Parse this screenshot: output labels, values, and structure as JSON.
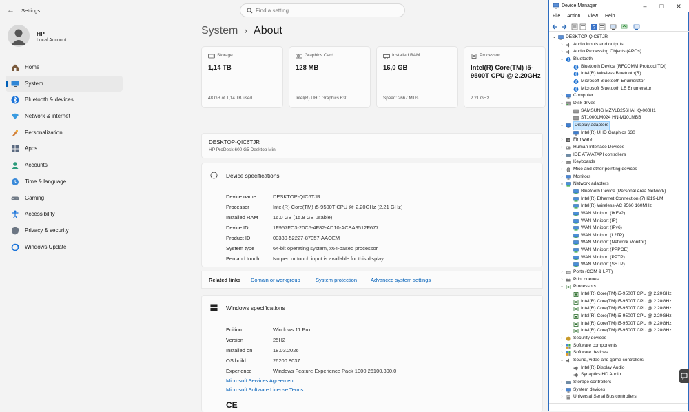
{
  "settings": {
    "title": "Settings",
    "search_placeholder": "Find a setting",
    "user": {
      "name": "HP",
      "account": "Local Account"
    },
    "nav": [
      {
        "label": "Home",
        "icon": "home-icon"
      },
      {
        "label": "System",
        "icon": "monitor-icon",
        "active": true
      },
      {
        "label": "Bluetooth & devices",
        "icon": "bluetooth-icon"
      },
      {
        "label": "Network & internet",
        "icon": "wifi-icon"
      },
      {
        "label": "Personalization",
        "icon": "brush-icon"
      },
      {
        "label": "Apps",
        "icon": "apps-icon"
      },
      {
        "label": "Accounts",
        "icon": "person-icon"
      },
      {
        "label": "Time & language",
        "icon": "globe-clock-icon"
      },
      {
        "label": "Gaming",
        "icon": "gamepad-icon"
      },
      {
        "label": "Accessibility",
        "icon": "accessibility-icon"
      },
      {
        "label": "Privacy & security",
        "icon": "shield-icon"
      },
      {
        "label": "Windows Update",
        "icon": "update-icon"
      }
    ],
    "breadcrumb": {
      "parent": "System",
      "sep": "›",
      "current": "About"
    },
    "cards": [
      {
        "label": "Storage",
        "value": "1,14 TB",
        "sub": "48 GB of 1,14 TB used",
        "icon": "storage-icon"
      },
      {
        "label": "Graphics Card",
        "value": "128 MB",
        "sub": "Intel(R) UHD Graphics 630",
        "icon": "graphics-card-icon"
      },
      {
        "label": "Installed RAM",
        "value": "16,0 GB",
        "sub": "Speed: 2667 MT/s",
        "icon": "ram-icon"
      },
      {
        "label": "Processor",
        "value": "Intel(R) Core(TM) i5-9500T CPU @ 2.20GHz",
        "sub": "2.21 GHz",
        "icon": "cpu-icon"
      }
    ],
    "device": {
      "name": "DESKTOP-QIC6TJR",
      "model": "HP ProDesk 600 G5 Desktop Mini"
    },
    "device_specs": {
      "title": "Device specifications",
      "rows": [
        {
          "k": "Device name",
          "v": "DESKTOP-QIC6TJR"
        },
        {
          "k": "Processor",
          "v": "Intel(R) Core(TM) i5-9500T CPU @ 2.20GHz (2.21 GHz)"
        },
        {
          "k": "Installed RAM",
          "v": "16.0 GB (15.8 GB usable)"
        },
        {
          "k": "Device ID",
          "v": "1F957FC3-20C5-4F82-AD10-ACBA9512F677"
        },
        {
          "k": "Product ID",
          "v": "00330-52227-87057-AAOEM"
        },
        {
          "k": "System type",
          "v": "64-bit operating system, x64-based processor"
        },
        {
          "k": "Pen and touch",
          "v": "No pen or touch input is available for this display"
        }
      ]
    },
    "related": {
      "label": "Related links",
      "links": [
        "Domain or workgroup",
        "System protection",
        "Advanced system settings"
      ]
    },
    "windows_specs": {
      "title": "Windows specifications",
      "rows": [
        {
          "k": "Edition",
          "v": "Windows 11 Pro"
        },
        {
          "k": "Version",
          "v": "25H2"
        },
        {
          "k": "Installed on",
          "v": "18.03.2026"
        },
        {
          "k": "OS build",
          "v": "26200.8037"
        },
        {
          "k": "Experience",
          "v": "Windows Feature Experience Pack 1000.26100.300.0"
        }
      ],
      "links": [
        "Microsoft Services Agreement",
        "Microsoft Software License Terms"
      ],
      "ce": "CE"
    }
  },
  "device_manager": {
    "title": "Device Manager",
    "menu": [
      "File",
      "Action",
      "View",
      "Help"
    ],
    "tree": [
      {
        "d": 0,
        "e": "v",
        "label": "DESKTOP-QIC6TJR",
        "icon": "computer-icon"
      },
      {
        "d": 1,
        "e": ">",
        "label": "Audio inputs and outputs",
        "icon": "speaker-icon"
      },
      {
        "d": 1,
        "e": ">",
        "label": "Audio Processing Objects (APOs)",
        "icon": "speaker-icon"
      },
      {
        "d": 1,
        "e": "v",
        "label": "Bluetooth",
        "icon": "bluetooth-icon"
      },
      {
        "d": 2,
        "e": "",
        "label": "Bluetooth Device (RFCOMM Protocol TDI)",
        "icon": "bluetooth-icon"
      },
      {
        "d": 2,
        "e": "",
        "label": "Intel(R) Wireless Bluetooth(R)",
        "icon": "bluetooth-icon"
      },
      {
        "d": 2,
        "e": "",
        "label": "Microsoft Bluetooth Enumerator",
        "icon": "bluetooth-icon"
      },
      {
        "d": 2,
        "e": "",
        "label": "Microsoft Bluetooth LE Enumerator",
        "icon": "bluetooth-icon"
      },
      {
        "d": 1,
        "e": ">",
        "label": "Computer",
        "icon": "monitor-icon"
      },
      {
        "d": 1,
        "e": "v",
        "label": "Disk drives",
        "icon": "disk-icon"
      },
      {
        "d": 2,
        "e": "",
        "label": "SAMSUNG MZVLB256HAHQ-000H1",
        "icon": "disk-icon"
      },
      {
        "d": 2,
        "e": "",
        "label": "ST1000LM024 HN-M101MBB",
        "icon": "disk-icon"
      },
      {
        "d": 1,
        "e": "v",
        "label": "Display adapters",
        "icon": "display-icon",
        "sel": true
      },
      {
        "d": 2,
        "e": "",
        "label": "Intel(R) UHD Graphics 630",
        "icon": "display-icon"
      },
      {
        "d": 1,
        "e": ">",
        "label": "Firmware",
        "icon": "chip-icon"
      },
      {
        "d": 1,
        "e": ">",
        "label": "Human Interface Devices",
        "icon": "hid-icon"
      },
      {
        "d": 1,
        "e": ">",
        "label": "IDE ATA/ATAPI controllers",
        "icon": "controller-icon"
      },
      {
        "d": 1,
        "e": ">",
        "label": "Keyboards",
        "icon": "keyboard-icon"
      },
      {
        "d": 1,
        "e": ">",
        "label": "Mice and other pointing devices",
        "icon": "mouse-icon"
      },
      {
        "d": 1,
        "e": ">",
        "label": "Monitors",
        "icon": "monitor-icon"
      },
      {
        "d": 1,
        "e": "v",
        "label": "Network adapters",
        "icon": "network-icon"
      },
      {
        "d": 2,
        "e": "",
        "label": "Bluetooth Device (Personal Area Network)",
        "icon": "network-icon"
      },
      {
        "d": 2,
        "e": "",
        "label": "Intel(R) Ethernet Connection (7) I219-LM",
        "icon": "network-icon"
      },
      {
        "d": 2,
        "e": "",
        "label": "Intel(R) Wireless-AC 9560 160MHz",
        "icon": "network-icon"
      },
      {
        "d": 2,
        "e": "",
        "label": "WAN Miniport (IKEv2)",
        "icon": "network-icon"
      },
      {
        "d": 2,
        "e": "",
        "label": "WAN Miniport (IP)",
        "icon": "network-icon"
      },
      {
        "d": 2,
        "e": "",
        "label": "WAN Miniport (IPv6)",
        "icon": "network-icon"
      },
      {
        "d": 2,
        "e": "",
        "label": "WAN Miniport (L2TP)",
        "icon": "network-icon"
      },
      {
        "d": 2,
        "e": "",
        "label": "WAN Miniport (Network Monitor)",
        "icon": "network-icon"
      },
      {
        "d": 2,
        "e": "",
        "label": "WAN Miniport (PPPOE)",
        "icon": "network-icon"
      },
      {
        "d": 2,
        "e": "",
        "label": "WAN Miniport (PPTP)",
        "icon": "network-icon"
      },
      {
        "d": 2,
        "e": "",
        "label": "WAN Miniport (SSTP)",
        "icon": "network-icon"
      },
      {
        "d": 1,
        "e": ">",
        "label": "Ports (COM & LPT)",
        "icon": "port-icon"
      },
      {
        "d": 1,
        "e": ">",
        "label": "Print queues",
        "icon": "printer-icon"
      },
      {
        "d": 1,
        "e": "v",
        "label": "Processors",
        "icon": "cpu-icon"
      },
      {
        "d": 2,
        "e": "",
        "label": "Intel(R) Core(TM) i5-9500T CPU @ 2.20GHz",
        "icon": "cpu-icon"
      },
      {
        "d": 2,
        "e": "",
        "label": "Intel(R) Core(TM) i5-9500T CPU @ 2.20GHz",
        "icon": "cpu-icon"
      },
      {
        "d": 2,
        "e": "",
        "label": "Intel(R) Core(TM) i5-9500T CPU @ 2.20GHz",
        "icon": "cpu-icon"
      },
      {
        "d": 2,
        "e": "",
        "label": "Intel(R) Core(TM) i5-9500T CPU @ 2.20GHz",
        "icon": "cpu-icon"
      },
      {
        "d": 2,
        "e": "",
        "label": "Intel(R) Core(TM) i5-9500T CPU @ 2.20GHz",
        "icon": "cpu-icon"
      },
      {
        "d": 2,
        "e": "",
        "label": "Intel(R) Core(TM) i5-9500T CPU @ 2.20GHz",
        "icon": "cpu-icon"
      },
      {
        "d": 1,
        "e": ">",
        "label": "Security devices",
        "icon": "security-icon"
      },
      {
        "d": 1,
        "e": ">",
        "label": "Software components",
        "icon": "component-icon"
      },
      {
        "d": 1,
        "e": ">",
        "label": "Software devices",
        "icon": "component-icon"
      },
      {
        "d": 1,
        "e": "v",
        "label": "Sound, video and game controllers",
        "icon": "speaker-icon"
      },
      {
        "d": 2,
        "e": "",
        "label": "Intel(R) Display Audio",
        "icon": "speaker-icon"
      },
      {
        "d": 2,
        "e": "",
        "label": "Synaptics HD Audio",
        "icon": "speaker-icon"
      },
      {
        "d": 1,
        "e": ">",
        "label": "Storage controllers",
        "icon": "controller-icon"
      },
      {
        "d": 1,
        "e": ">",
        "label": "System devices",
        "icon": "monitor-icon"
      },
      {
        "d": 1,
        "e": ">",
        "label": "Universal Serial Bus controllers",
        "icon": "usb-icon"
      }
    ]
  },
  "colors": {
    "accent": "#005fb8",
    "link": "#005fb8",
    "selection": "#cce8ff"
  }
}
